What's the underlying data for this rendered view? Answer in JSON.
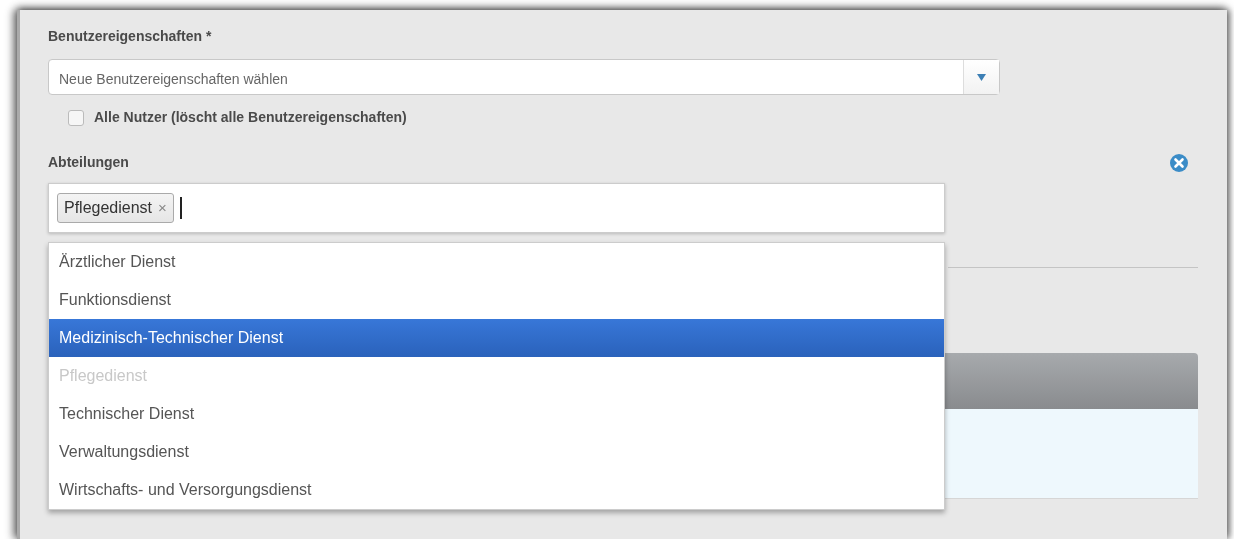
{
  "properties": {
    "label": "Benutzereigenschaften *",
    "placeholder": "Neue Benutzereigenschaften wählen"
  },
  "all_users": {
    "label": "Alle Nutzer (löscht alle Benutzereigenschaften)",
    "checked": false
  },
  "departments": {
    "label": "Abteilungen",
    "tags": [
      {
        "label": "Pflegedienst",
        "remove": "×"
      }
    ],
    "options": [
      {
        "label": "Ärztlicher Dienst",
        "selected": false,
        "disabled": false
      },
      {
        "label": "Funktionsdienst",
        "selected": false,
        "disabled": false
      },
      {
        "label": "Medizinisch-Technischer Dienst",
        "selected": true,
        "disabled": false
      },
      {
        "label": "Pflegedienst",
        "selected": false,
        "disabled": true
      },
      {
        "label": "Technischer Dienst",
        "selected": false,
        "disabled": false
      },
      {
        "label": "Verwaltungsdienst",
        "selected": false,
        "disabled": false
      },
      {
        "label": "Wirtschafts- und Versorgungsdienst",
        "selected": false,
        "disabled": false
      }
    ]
  }
}
